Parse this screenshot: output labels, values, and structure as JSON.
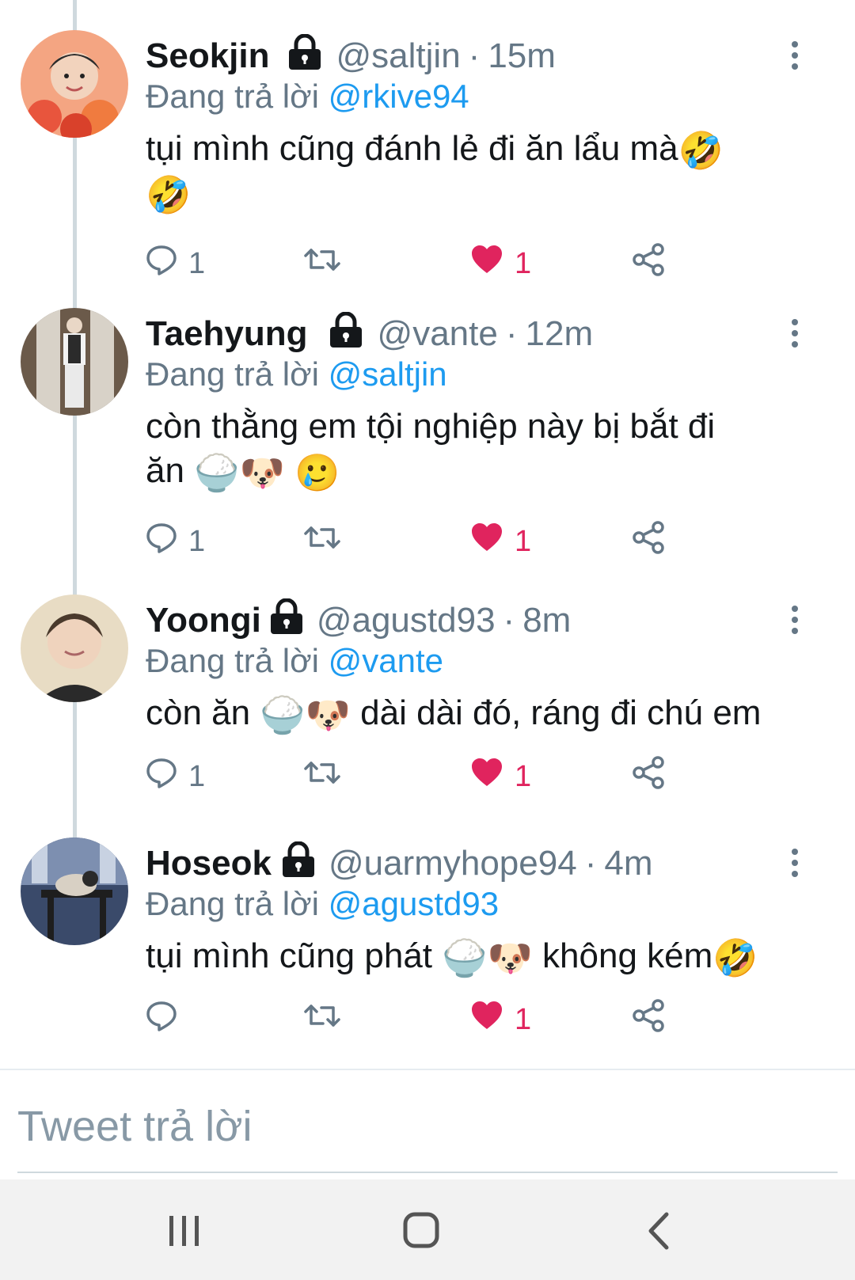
{
  "tweets": [
    {
      "name": "Seokjin",
      "handle": "@saltjin",
      "sep": "·",
      "time": "15m",
      "reply_prefix": "Đang trả lời",
      "reply_to": "@rkive94",
      "text_parts": [
        "tụi mình cũng đánh lẻ đi ăn lẩu mà",
        "🤣",
        "🤣"
      ],
      "replies": "1",
      "likes": "1",
      "liked": true
    },
    {
      "name": "Taehyung",
      "handle": "@vante",
      "sep": "·",
      "time": "12m",
      "reply_prefix": "Đang trả lời",
      "reply_to": "@saltjin",
      "text_parts": [
        "còn thằng em tội nghiệp này bị bắt đi",
        "ăn",
        "🍚🐶",
        "🥲"
      ],
      "replies": "1",
      "likes": "1",
      "liked": true
    },
    {
      "name": "Yoongi",
      "handle": "@agustd93",
      "sep": "·",
      "time": "8m",
      "reply_prefix": "Đang trả lời",
      "reply_to": "@vante",
      "text_parts": [
        "còn ăn",
        "🍚🐶",
        "dài dài đó, ráng đi chú em"
      ],
      "replies": "1",
      "likes": "1",
      "liked": true
    },
    {
      "name": "Hoseok",
      "handle": "@uarmyhope94",
      "sep": "·",
      "time": "4m",
      "reply_prefix": "Đang trả lời",
      "reply_to": "@agustd93",
      "text_parts": [
        "tụi mình cũng phát",
        "🍚🐶",
        "không kém",
        "🤣"
      ],
      "replies": "",
      "likes": "1",
      "liked": true
    }
  ],
  "reply_box": {
    "placeholder": "Tweet trả lời"
  },
  "colors": {
    "accent": "#1d9bf0",
    "like": "#e0245e",
    "muted": "#657786",
    "thread_line": "#cfd9de"
  },
  "icons": {
    "reply": "speech-bubble-icon",
    "retweet": "retweet-arrows-icon",
    "like": "heart-icon",
    "share": "share-nodes-icon",
    "more": "vertical-dots-icon",
    "lock": "lock-icon",
    "nav_recent": "recent-apps-icon",
    "nav_home": "home-icon",
    "nav_back": "back-chevron-icon"
  }
}
